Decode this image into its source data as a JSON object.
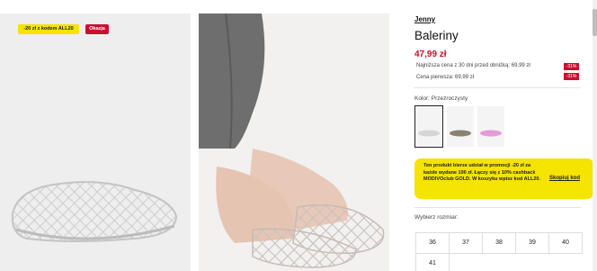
{
  "gallery": {
    "badge_promo": "-20 zł z kodem ALL20",
    "badge_sale": "Okazja"
  },
  "product": {
    "brand": "Jenny",
    "title": "Baleriny",
    "price": "47,99 zł",
    "lowest_price": "Najniższa cena z 30 dni przed obniżką: 69,99 zł",
    "lowest_pct": "-31%",
    "first_price": "Cena pierwsza: 69,99 zł",
    "first_pct": "-31%"
  },
  "colors": {
    "label": "Kolor: Przezroczysty",
    "swatches": [
      {
        "name": "Przezroczysty",
        "color": "#d6d6d6"
      },
      {
        "name": "Khaki",
        "color": "#8a8272"
      },
      {
        "name": "Różowy",
        "color": "#e59bd8"
      }
    ]
  },
  "promo": {
    "text": "Ten produkt bierze udział w promocji -20 zł za każde wydane 100 zł. Łączy się z 10% cashback MODIVOclub GOLD. W koszyku wpisz kod ALL20.",
    "link": "Skopiuj kod"
  },
  "sizes": {
    "label": "Wybierz rozmiar:",
    "options": [
      "36",
      "37",
      "38",
      "39",
      "40",
      "41"
    ]
  }
}
